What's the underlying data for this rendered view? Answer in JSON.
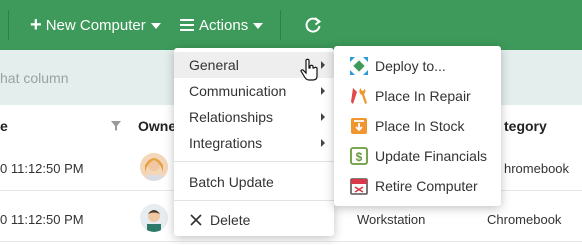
{
  "toolbar": {
    "new_computer_label": "New Computer",
    "actions_label": "Actions",
    "refresh_icon": "refresh-icon",
    "bg_color": "#3d9a5a"
  },
  "groupbar": {
    "placeholder": "hat column"
  },
  "table": {
    "columns": [
      "e",
      "Owner",
      "tegory"
    ],
    "rows": [
      {
        "date": "0 11:12:50 PM",
        "type": "",
        "category": "hromebook"
      },
      {
        "date": "0 11:12:50 PM",
        "type": "Workstation",
        "category": "Chromebook"
      }
    ]
  },
  "actions_menu": {
    "items": [
      {
        "label": "General",
        "has_submenu": true,
        "active": true
      },
      {
        "label": "Communication",
        "has_submenu": true
      },
      {
        "label": "Relationships",
        "has_submenu": true
      },
      {
        "label": "Integrations",
        "has_submenu": true
      },
      {
        "label": "Batch Update"
      },
      {
        "label": "Delete",
        "icon": "close-icon"
      }
    ]
  },
  "general_submenu": {
    "items": [
      {
        "label": "Deploy to...",
        "icon": "deploy-icon",
        "color": "#2d9bd6"
      },
      {
        "label": "Place In Repair",
        "icon": "repair-icon",
        "color": "#e04848"
      },
      {
        "label": "Place In Stock",
        "icon": "stock-icon",
        "color": "#f0962f"
      },
      {
        "label": "Update Financials",
        "icon": "financials-icon",
        "color": "#6a9a3a"
      },
      {
        "label": "Retire Computer",
        "icon": "retire-icon",
        "color": "#d9384a"
      }
    ]
  }
}
